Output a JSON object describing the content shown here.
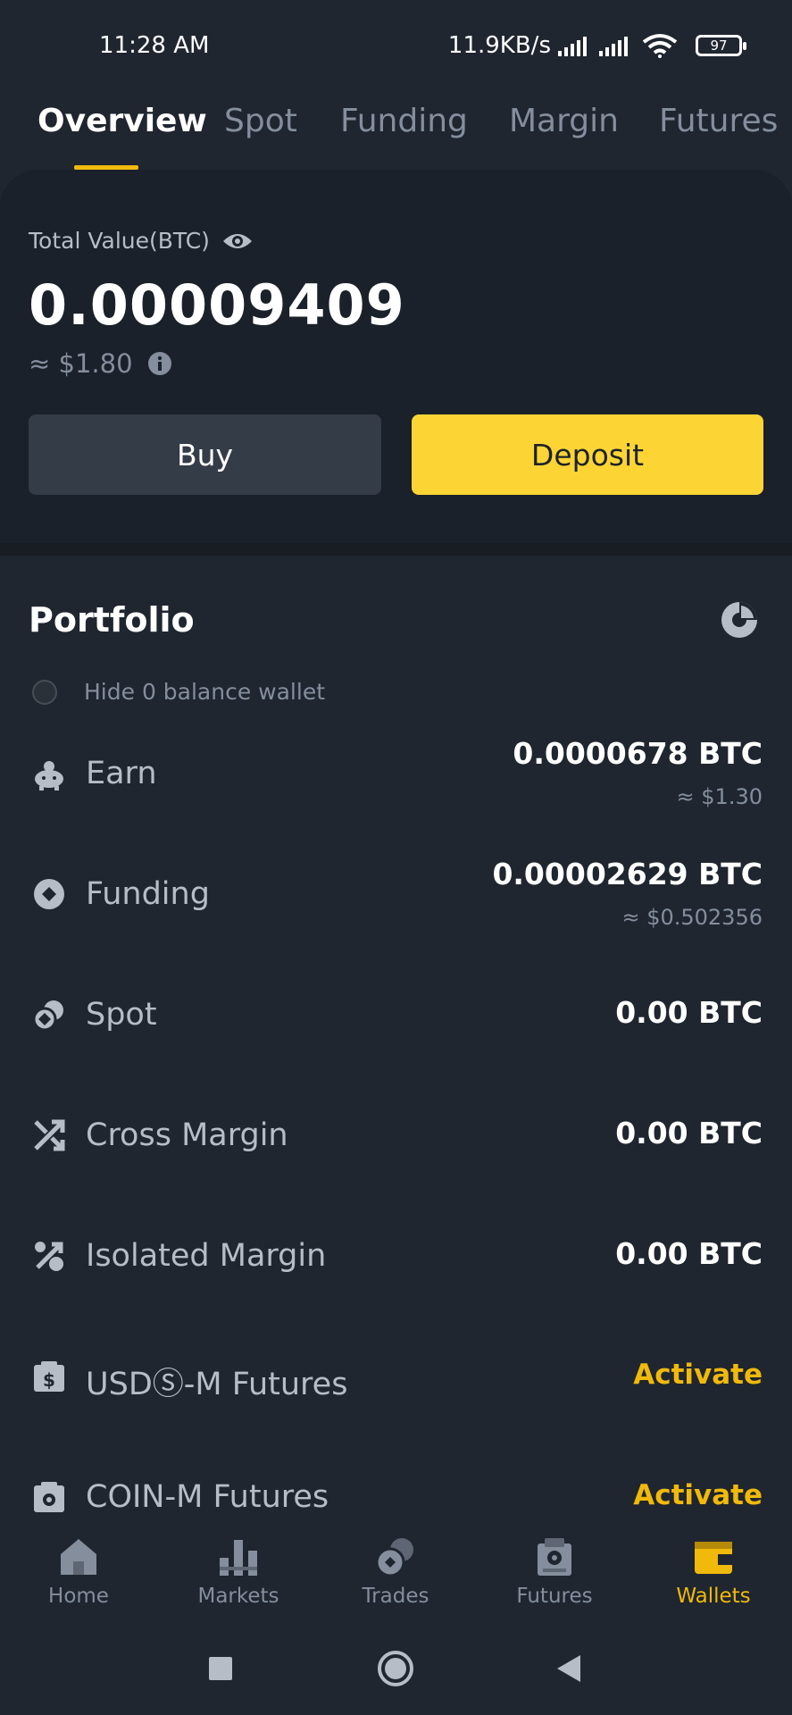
{
  "status_bar": {
    "time": "11:28 AM",
    "speed": "11.9KB/s",
    "battery": "97"
  },
  "tabs": [
    "Overview",
    "Spot",
    "Funding",
    "Margin",
    "Futures"
  ],
  "summary": {
    "total_label": "Total Value(BTC)",
    "total_value": "0.00009409",
    "usd_value": "≈ $1.80",
    "buy_label": "Buy",
    "deposit_label": "Deposit"
  },
  "portfolio": {
    "title": "Portfolio",
    "hide_zero_label": "Hide 0 balance wallet",
    "items": [
      {
        "name": "Earn",
        "amount": "0.0000678 BTC",
        "usd": "≈ $1.30",
        "icon": "piggy-bank-icon"
      },
      {
        "name": "Funding",
        "amount": "0.00002629 BTC",
        "usd": "≈ $0.502356",
        "icon": "funding-icon"
      },
      {
        "name": "Spot",
        "amount": "0.00 BTC",
        "icon": "spot-icon"
      },
      {
        "name": "Cross Margin",
        "amount": "0.00 BTC",
        "icon": "cross-arrows-icon"
      },
      {
        "name": "Isolated Margin",
        "amount": "0.00 BTC",
        "icon": "percent-icon"
      },
      {
        "name": "USDⓈ-M Futures",
        "action": "Activate",
        "icon": "usd-futures-icon"
      },
      {
        "name": "COIN-M Futures",
        "action": "Activate",
        "icon": "coin-futures-icon"
      }
    ]
  },
  "bottom_nav": [
    "Home",
    "Markets",
    "Trades",
    "Futures",
    "Wallets"
  ],
  "colors": {
    "accent": "#f0b90b",
    "button_yellow": "#fcd535",
    "background": "#1f2630",
    "muted": "#848e9c"
  }
}
